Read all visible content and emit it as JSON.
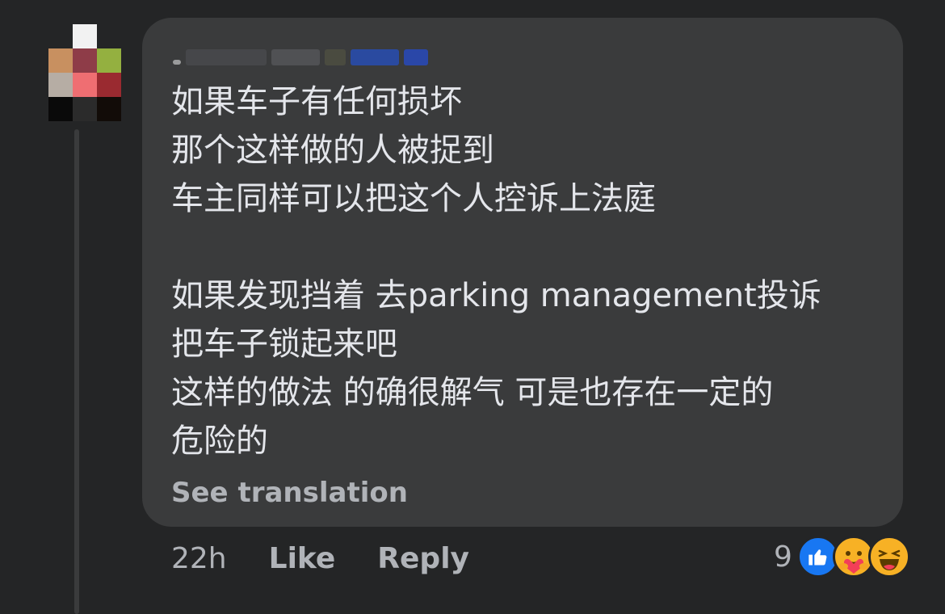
{
  "comment": {
    "author_name": "",
    "lines": [
      "如果车子有任何损坏",
      "那个这样做的人被捉到",
      "车主同样可以把这个人控诉上法庭",
      "",
      "如果发现挡着 去parking management投诉",
      "把车子锁起来吧",
      "这样的做法 的确很解气 可是也存在一定的",
      "危险的"
    ],
    "see_translation": "See translation"
  },
  "actions": {
    "time": "22h",
    "like": "Like",
    "reply": "Reply"
  },
  "reactions": {
    "count": "9",
    "icons": [
      "like-icon",
      "care-icon",
      "haha-icon"
    ]
  },
  "colors": {
    "background": "#242526",
    "bubble": "#3a3b3c",
    "text": "#e4e6eb",
    "secondary_text": "#b0b3b8",
    "like_blue": "#1877f2",
    "reaction_yellow": "#f7b125"
  }
}
